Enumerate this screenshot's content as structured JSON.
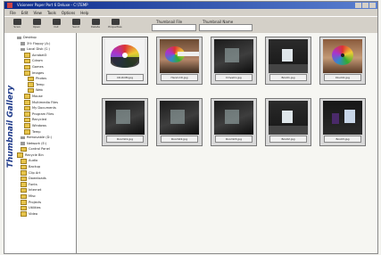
{
  "window": {
    "title": "Visioneer Paper Port 6 Deluxe - C:\\TEMP"
  },
  "menu": [
    "File",
    "Edit",
    "View",
    "Tools",
    "Options",
    "Help"
  ],
  "toolbar": {
    "buttons": [
      {
        "label": "Scan",
        "icon": "scanner-icon"
      },
      {
        "label": "Open",
        "icon": "folder-icon"
      },
      {
        "label": "Cut",
        "icon": "scissors-icon"
      },
      {
        "label": "Send",
        "icon": "send-icon"
      },
      {
        "label": "Delete",
        "icon": "trash-icon"
      },
      {
        "label": "Properties",
        "icon": "properties-icon"
      }
    ],
    "thumbnail_file_label": "Thumbnail File",
    "thumbnail_name_label": "Thumbnail Name"
  },
  "sidebar": {
    "brand": "Thumbnail Gallery",
    "tree": [
      {
        "label": "Desktop",
        "type": "drive",
        "indent": 0
      },
      {
        "label": "3½ Floppy (A:)",
        "type": "drive",
        "indent": 1
      },
      {
        "label": "Local Disk (C:)",
        "type": "drive",
        "indent": 1
      },
      {
        "label": "Acrobat3",
        "type": "folder",
        "indent": 2
      },
      {
        "label": "Cdrom",
        "type": "folder",
        "indent": 2
      },
      {
        "label": "Games",
        "type": "folder",
        "indent": 2
      },
      {
        "label": "Images",
        "type": "folder",
        "indent": 2
      },
      {
        "label": "Photos",
        "type": "folder",
        "indent": 3
      },
      {
        "label": "Temp",
        "type": "folder",
        "indent": 3
      },
      {
        "label": "Web",
        "type": "folder",
        "indent": 3
      },
      {
        "label": "Mouse",
        "type": "folder",
        "indent": 2
      },
      {
        "label": "Multimedia Files",
        "type": "folder",
        "indent": 2
      },
      {
        "label": "My Documents",
        "type": "folder",
        "indent": 2
      },
      {
        "label": "Program Files",
        "type": "folder",
        "indent": 2
      },
      {
        "label": "Recycled",
        "type": "folder",
        "indent": 2
      },
      {
        "label": "Windows",
        "type": "folder",
        "indent": 2
      },
      {
        "label": "Temp",
        "type": "folder",
        "indent": 2
      },
      {
        "label": "Removable (D:)",
        "type": "drive",
        "indent": 1
      },
      {
        "label": "Network (E:)",
        "type": "drive",
        "indent": 1
      },
      {
        "label": "Control Panel",
        "type": "folder",
        "indent": 1
      },
      {
        "label": "Recycle Bin",
        "type": "folder",
        "indent": 0
      },
      {
        "label": "Audio",
        "type": "folder",
        "indent": 1
      },
      {
        "label": "Backup",
        "type": "folder",
        "indent": 1
      },
      {
        "label": "Clip Art",
        "type": "folder",
        "indent": 1
      },
      {
        "label": "Downloads",
        "type": "folder",
        "indent": 1
      },
      {
        "label": "Fonts",
        "type": "folder",
        "indent": 1
      },
      {
        "label": "Internet",
        "type": "folder",
        "indent": 1
      },
      {
        "label": "Misc",
        "type": "folder",
        "indent": 1
      },
      {
        "label": "Projects",
        "type": "folder",
        "indent": 1
      },
      {
        "label": "Utilities",
        "type": "folder",
        "indent": 1
      },
      {
        "label": "Video",
        "type": "folder",
        "indent": 1
      }
    ]
  },
  "thumbnails": [
    {
      "caption": "CD-ROM.jpg",
      "image": "img-cd",
      "selected": true
    },
    {
      "caption": "Hand-CD.jpg",
      "image": "img-hand",
      "selected": false
    },
    {
      "caption": "Drive01.jpg",
      "image": "img-dark",
      "selected": false
    },
    {
      "caption": "Box01.jpg",
      "image": "img-room",
      "selected": false
    },
    {
      "caption": "Disc02.jpg",
      "image": "img-disc2",
      "selected": false
    },
    {
      "caption": "Room01.jpg",
      "image": "img-dark",
      "selected": false
    },
    {
      "caption": "Room02.jpg",
      "image": "img-dark",
      "selected": false
    },
    {
      "caption": "Room03.jpg",
      "image": "img-dark",
      "selected": false
    },
    {
      "caption": "Box02.jpg",
      "image": "img-room",
      "selected": false
    },
    {
      "caption": "Box03.jpg",
      "image": "img-blue",
      "selected": false
    }
  ]
}
